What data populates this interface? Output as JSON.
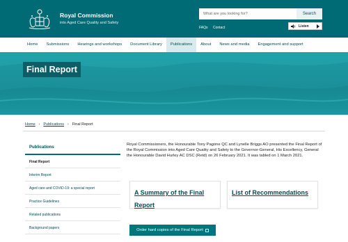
{
  "header": {
    "brand_title": "Royal Commission",
    "brand_subtitle": "into Aged Care Quality and Safety",
    "search_placeholder": "What are you looking for?",
    "search_button": "Search",
    "utility_links": [
      "FAQs",
      "Contact"
    ],
    "listen_label": "Listen"
  },
  "nav": {
    "items": [
      "Home",
      "Submissions",
      "Hearings and workshops",
      "Document Library",
      "Publications",
      "About",
      "News and media",
      "Engagement and support"
    ],
    "active": "Publications"
  },
  "hero": {
    "title": "Final Report"
  },
  "breadcrumb": {
    "items": [
      "Home",
      "Publications",
      "Final Report"
    ]
  },
  "sidebar": {
    "heading": "Publications",
    "items": [
      "Final Report",
      "Interim Report",
      "Aged care and COVID-19: a special report",
      "Practice Guidelines",
      "Related publications",
      "Background papers"
    ],
    "active": "Final Report"
  },
  "main": {
    "intro": "Royal Commissioners, the Honourable Tony Pagone QC and Lynelle Briggs AO presented the Final Report of the Royal Commission into Aged Care Quality and Safety to the Governor-General, His Excellency, General the Honourable David Hurley AC DSC (Retd) on 26 February 2021. It was tabled on 1 March 2021.",
    "cards": [
      "A Summary of the Final Report",
      "List of Recommendations"
    ],
    "order_button": "Order hard copies of the Final Report"
  },
  "colors": {
    "header_bg": "#006a75",
    "hero_bg": "#1b9aa3",
    "hero_title_bg": "#0d5d66",
    "link": "#004d56",
    "button_bg": "#007580"
  },
  "icons": [
    "crest-logo-icon",
    "speaker-icon",
    "play-icon",
    "chevron-right-icon",
    "external-link-icon"
  ]
}
